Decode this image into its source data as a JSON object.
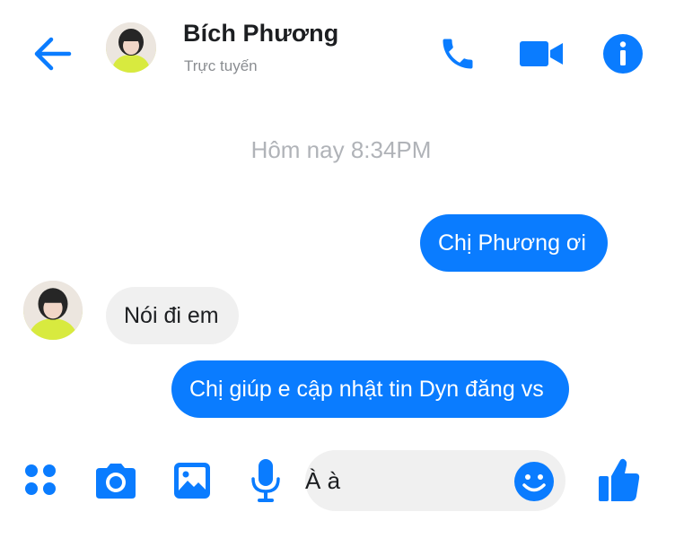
{
  "header": {
    "contact_name": "Bích Phương",
    "status": "Trực tuyến",
    "icons": {
      "back": "back-arrow-icon",
      "call": "phone-icon",
      "video": "video-camera-icon",
      "info": "info-icon"
    }
  },
  "conversation": {
    "timestamp": "Hôm nay 8:34PM",
    "messages": [
      {
        "direction": "outgoing",
        "text": "Chị Phương ơi"
      },
      {
        "direction": "incoming",
        "text": "Nói đi em"
      },
      {
        "direction": "outgoing",
        "text": "Chị giúp e cập nhật tin Dyn đăng vs"
      }
    ]
  },
  "composer": {
    "input_text": "À à",
    "icons": {
      "apps": "four-dots-icon",
      "camera": "camera-icon",
      "gallery": "image-icon",
      "mic": "microphone-icon",
      "emoji": "smiley-icon",
      "like": "thumbs-up-icon"
    }
  },
  "colors": {
    "accent": "#0a7cff",
    "incoming_bubble": "#f0f0f0",
    "muted_text": "#8a8d91",
    "timestamp_text": "#b0b3b8"
  }
}
